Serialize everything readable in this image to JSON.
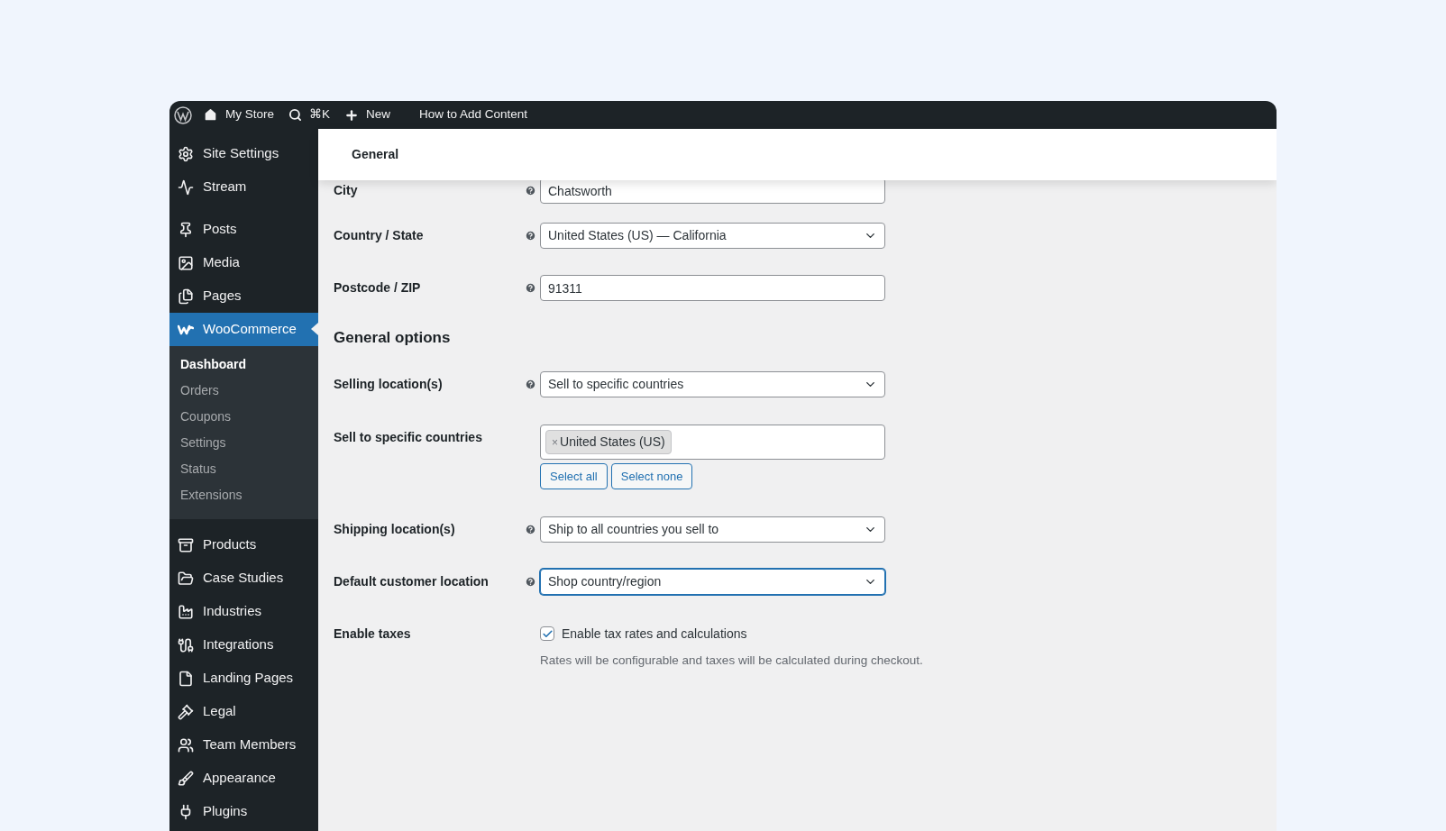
{
  "top_bar": {
    "items": [
      {
        "kind": "logo"
      },
      {
        "kind": "home",
        "label": "My Store"
      },
      {
        "kind": "search",
        "label": "⌘K"
      },
      {
        "kind": "new",
        "label": "New"
      },
      {
        "kind": "text",
        "label": "How to Add Content"
      }
    ]
  },
  "sidebar": {
    "items": [
      {
        "label": "Site Settings",
        "selected": false
      },
      {
        "label": "Stream",
        "selected": false
      },
      {
        "label": "Posts",
        "selected": false
      },
      {
        "label": "Media",
        "selected": false
      },
      {
        "label": "Pages",
        "selected": false
      },
      {
        "label": "WooCommerce",
        "selected": true,
        "children": [
          {
            "label": "Dashboard",
            "selected": true
          },
          {
            "label": "Orders",
            "selected": false
          },
          {
            "label": "Coupons",
            "selected": false
          },
          {
            "label": "Settings",
            "selected": false
          },
          {
            "label": "Status",
            "selected": false
          },
          {
            "label": "Extensions",
            "selected": false
          }
        ]
      },
      {
        "label": "Products",
        "selected": false
      },
      {
        "label": "Case Studies",
        "selected": false
      },
      {
        "label": "Industries",
        "selected": false
      },
      {
        "label": "Integrations",
        "selected": false
      },
      {
        "label": "Landing Pages",
        "selected": false
      },
      {
        "label": "Legal",
        "selected": false
      },
      {
        "label": "Team Members",
        "selected": false
      },
      {
        "label": "Appearance",
        "selected": false
      },
      {
        "label": "Plugins",
        "selected": false
      }
    ]
  },
  "header": {
    "title": "General"
  },
  "form": {
    "rows": [
      {
        "kind": "text",
        "label": "City",
        "value": "Chatsworth"
      },
      {
        "kind": "select",
        "label": "Country / State",
        "value": "United States (US) — California",
        "focused": false
      },
      {
        "kind": "text",
        "label": "Postcode / ZIP",
        "value": "91311"
      },
      {
        "kind": "heading",
        "label": "General options"
      },
      {
        "kind": "select",
        "label": "Selling location(s)",
        "value": "Sell to specific countries",
        "focused": false
      },
      {
        "kind": "multiselect",
        "label": "Sell to specific countries",
        "tags": [
          {
            "remove": "×",
            "label": "United States (US)"
          }
        ],
        "buttons": [
          "Select all",
          "Select none"
        ]
      },
      {
        "kind": "select",
        "label": "Shipping location(s)",
        "value": "Ship to all countries you sell to",
        "focused": false
      },
      {
        "kind": "select",
        "label": "Default customer location",
        "value": "Shop country/region",
        "focused": true
      },
      {
        "kind": "checkbox",
        "label": "Enable taxes",
        "checked": true,
        "option": "Enable tax rates and calculations",
        "description": "Rates will be configurable and taxes will be calculated during checkout."
      }
    ]
  }
}
